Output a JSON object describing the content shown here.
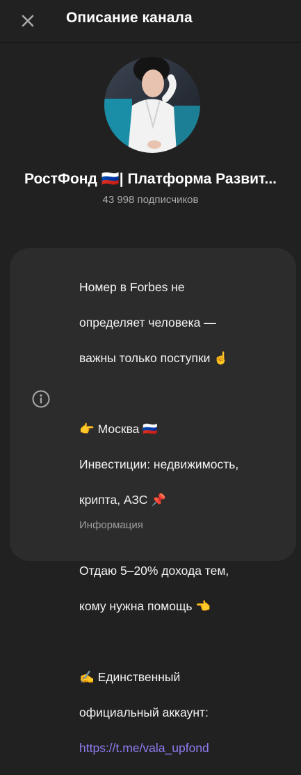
{
  "header": {
    "title": "Описание канала",
    "close_icon": "close-icon"
  },
  "channel": {
    "name": "РостФонд 🇷🇺| Платформа Развит...",
    "subscribers": "43 998 подписчиков",
    "avatar_icon": "channel-avatar"
  },
  "description": {
    "lines": [
      "Номер в Forbes не",
      "определяет человека —",
      "важны только поступки ☝️",
      "",
      "👉 Москва 🇷🇺",
      "Инвестиции: недвижимость,",
      "крипта, АЗС 📌",
      "",
      "Отдаю 5–20% дохода тем,",
      "кому нужна помощь 👈",
      "",
      "✍️ Единственный",
      "официальный аккаунт:"
    ],
    "link": "https://t.me/vala_upfond",
    "label": "Информация",
    "icon": "info-icon"
  },
  "colors": {
    "background": "#212121",
    "card": "#2c2c2c",
    "link": "#8e7cf0",
    "secondary_text": "#aaaaaa"
  }
}
